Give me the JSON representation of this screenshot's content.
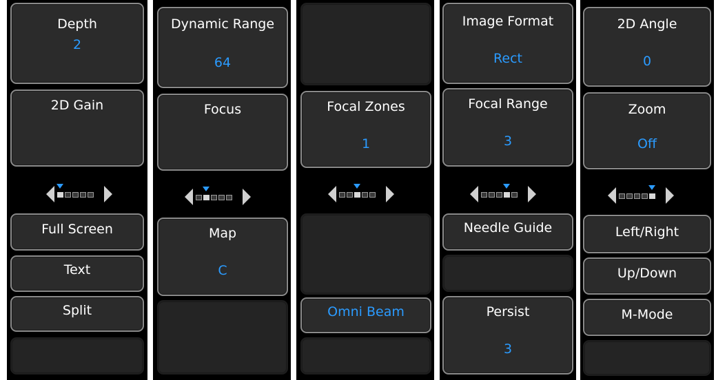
{
  "panels": [
    {
      "buttons": [
        {
          "label": "Depth",
          "value": "2"
        },
        {
          "label": "2D Gain",
          "value": ""
        },
        {
          "label": "Full Screen",
          "value": ""
        },
        {
          "label": "Text",
          "value": ""
        },
        {
          "label": "Split",
          "value": ""
        }
      ],
      "pager": {
        "page": 1,
        "pages": 5
      }
    },
    {
      "buttons": [
        {
          "label": "Dynamic Range",
          "value": "64"
        },
        {
          "label": "Focus",
          "value": ""
        },
        {
          "label": "Map",
          "value": "C"
        }
      ],
      "pager": {
        "page": 2,
        "pages": 5
      }
    },
    {
      "buttons": [
        {
          "label": "Focal Zones",
          "value": "1"
        },
        {
          "label": "Omni Beam",
          "value": ""
        }
      ],
      "pager": {
        "page": 3,
        "pages": 5
      }
    },
    {
      "buttons": [
        {
          "label": "Image Format",
          "value": "Rect"
        },
        {
          "label": "Focal Range",
          "value": "3"
        },
        {
          "label": "Needle Guide",
          "value": ""
        },
        {
          "label": "Persist",
          "value": "3"
        }
      ],
      "pager": {
        "page": 4,
        "pages": 5
      }
    },
    {
      "buttons": [
        {
          "label": "2D Angle",
          "value": "0"
        },
        {
          "label": "Zoom",
          "value": "Off"
        },
        {
          "label": "Left/Right",
          "value": ""
        },
        {
          "label": "Up/Down",
          "value": ""
        },
        {
          "label": "M-Mode",
          "value": ""
        }
      ],
      "pager": {
        "page": 5,
        "pages": 5
      }
    }
  ],
  "colors": {
    "accent": "#2b9bff",
    "panel": "#000000",
    "button": "#2b2b2b",
    "border": "#8a8a8a"
  }
}
